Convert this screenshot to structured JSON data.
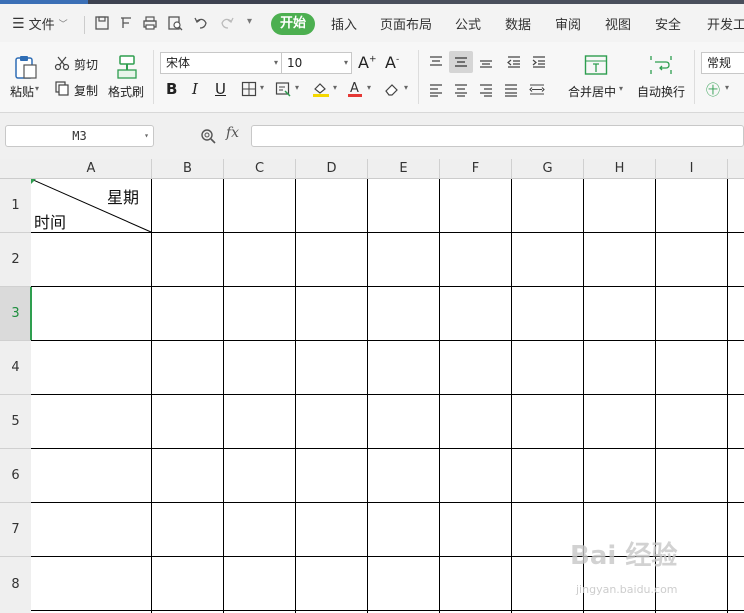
{
  "menu": {
    "file": "文件",
    "tabs": [
      "开始",
      "插入",
      "页面布局",
      "公式",
      "数据",
      "审阅",
      "视图",
      "安全",
      "开发工"
    ],
    "active_tab": "开始"
  },
  "ribbon": {
    "paste": "粘贴",
    "cut": "剪切",
    "copy": "复制",
    "format_painter": "格式刷",
    "font_name": "宋体",
    "font_size": "10",
    "merge_center": "合并居中",
    "wrap_text": "自动换行",
    "number_format": "常规"
  },
  "formula_bar": {
    "name_box": "M3",
    "fx": "fx",
    "formula": ""
  },
  "sheet": {
    "columns": [
      "A",
      "B",
      "C",
      "D",
      "E",
      "F",
      "G",
      "H",
      "I"
    ],
    "rows": [
      "1",
      "2",
      "3",
      "4",
      "5",
      "6",
      "7",
      "8"
    ],
    "active_row": "3",
    "cell_a1_top_right": "星期",
    "cell_a1_bottom_left": "时间"
  },
  "watermark": {
    "main": "Bai 经验",
    "sub": "jingyan.baidu.com"
  },
  "colors": {
    "accent": "#4caf50",
    "selection": "#2e9e4f"
  }
}
